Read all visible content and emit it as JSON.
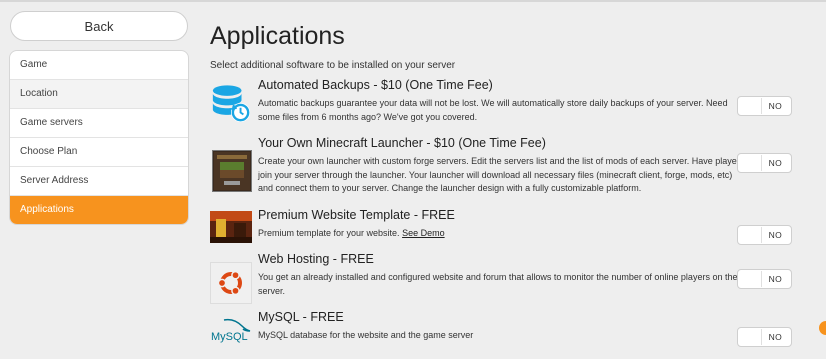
{
  "sidebar": {
    "back_label": "Back",
    "steps": [
      {
        "label": "Game"
      },
      {
        "label": "Location"
      },
      {
        "label": "Game servers"
      },
      {
        "label": "Choose Plan"
      },
      {
        "label": "Server Address"
      },
      {
        "label": "Applications"
      }
    ],
    "active_step": "Applications"
  },
  "main": {
    "title": "Applications",
    "subtitle": "Select additional software to be installed on your server",
    "items": [
      {
        "title": "Automated Backups - $10 (One Time Fee)",
        "description": "Automatic backups guarantee your data will not be lost. We will automatically store daily backups of your server. Need some files from 6 months ago? We've got you covered.",
        "toggle": "NO",
        "icon": "database-backup-icon"
      },
      {
        "title": "Your Own Minecraft Launcher - $10 (One Time Fee)",
        "description": "Create your own launcher with custom forge servers. Edit the servers list and the list of mods of each server. Have players join your server through the launcher. Your launcher will download all necessary files (minecraft client, forge, mods, etc) and connect them to your server. Change the launcher design with a fully customizable platform.",
        "toggle": "NO",
        "icon": "minecraft-launcher-icon"
      },
      {
        "title": "Premium Website Template - FREE",
        "description": "Premium template for your website.",
        "link": "See Demo",
        "toggle": "NO",
        "icon": "website-template-thumbnail"
      },
      {
        "title": "Web Hosting - FREE",
        "description": "You get an already installed and configured website and forum that allows to monitor the number of online players on the server.",
        "toggle": "NO",
        "icon": "ubuntu-icon"
      },
      {
        "title": "MySQL - FREE",
        "description": "MySQL database for the website and the game server",
        "toggle": "NO",
        "icon": "mysql-logo",
        "logo_text": "MySQL"
      }
    ]
  },
  "colors": {
    "accent": "#f7931e",
    "backup_icon": "#1aa6e4",
    "ubuntu": "#dd4814",
    "mysql_blue": "#00758f",
    "mysql_orange": "#f29111"
  }
}
